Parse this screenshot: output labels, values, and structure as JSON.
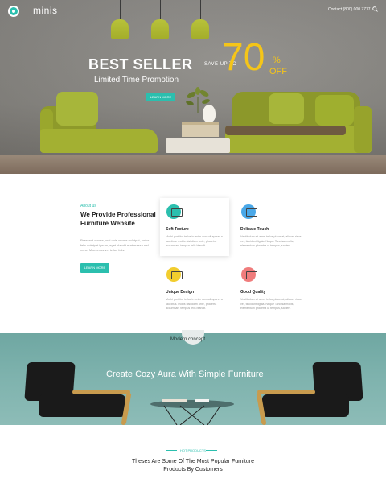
{
  "header": {
    "brand": "minis",
    "contact": "Contact (800) 000 7777",
    "icons": [
      "logo-icon",
      "search-icon"
    ]
  },
  "hero": {
    "title": "BEST SELLER",
    "subtitle": "Limited Time Promotion",
    "button_label": "LEARN MORE",
    "save_label": "SAVE UP TO",
    "discount_number": "70",
    "discount_percent": "%",
    "discount_off": "OFF"
  },
  "about": {
    "eyebrow": "About us",
    "title": "We Provide Professional Furniture Website",
    "text": "Praesent ornare, orci quis ornare volutpat, tortor felis volutpat ipsum, eget blandit erat massa nisl nunc. Maecenas vel tellus felis.",
    "button_label": "LEARN MORE"
  },
  "features": [
    {
      "title": "Soft Texture",
      "text": "Morbi porttitor tellus in enim consult aporet a faucibus. mollis nisi diam ante, pharetra accumsan, tempus felis blandit.",
      "icon": "sofa-icon",
      "color": "#2bbfae"
    },
    {
      "title": "Delicate Touch",
      "text": "Vestibulum sit amet tellus placerat, aliquet risus vel, tincidunt ligula. Neque Tandisa mollis, elementum pharetra ut tempus, sapien.",
      "icon": "cabinet-icon",
      "color": "#4aa8e8"
    },
    {
      "title": "Unique Design",
      "text": "Morbi porttitor tellus in enim consult aporet a faucibus. mollis nisi diam ante, pharetra accumsan, tempus felis blandit.",
      "icon": "frame-icon",
      "color": "#f2cd2e"
    },
    {
      "title": "Good Quality",
      "text": "Vestibulum sit amet tellus placerat, aliquet risus vel, tincidunt ligula. Neque Tandisa mollis, elementum pharetra ut tempus, sapien.",
      "icon": "chair-icon",
      "color": "#f07c7c"
    }
  ],
  "banner2": {
    "subtitle": "Modern concept",
    "title": "Create Cozy Aura With Simple Furniture"
  },
  "products": {
    "eyebrow": "HOT PRODUCTS",
    "title": "Theses Are Some Of The Most Popular Furniture Products By Customers"
  },
  "colors": {
    "accent": "#2bbfae",
    "promo": "#f5c518",
    "sofa": "#a3b032"
  }
}
